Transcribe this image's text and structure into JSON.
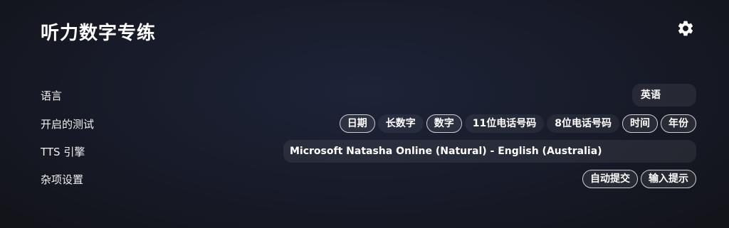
{
  "header": {
    "title": "听力数字专练",
    "settings_icon": "gear-icon"
  },
  "rows": {
    "language": {
      "label": "语言",
      "value": "英语"
    },
    "tests": {
      "label": "开启的测试",
      "options": [
        {
          "label": "日期",
          "active": true
        },
        {
          "label": "长数字",
          "active": false
        },
        {
          "label": "数字",
          "active": true
        },
        {
          "label": "11位电话号码",
          "active": false
        },
        {
          "label": "8位电话号码",
          "active": false
        },
        {
          "label": "时间",
          "active": true
        },
        {
          "label": "年份",
          "active": true
        }
      ]
    },
    "tts": {
      "label": "TTS 引擎",
      "value": "Microsoft Natasha Online (Natural) - English (Australia)"
    },
    "misc": {
      "label": "杂项设置",
      "options": [
        {
          "label": "自动提交",
          "active": true
        },
        {
          "label": "输入提示",
          "active": true
        }
      ]
    }
  },
  "colors": {
    "background": "#171a27",
    "text": "#ffffff",
    "active_border": "#cfcfcf"
  }
}
